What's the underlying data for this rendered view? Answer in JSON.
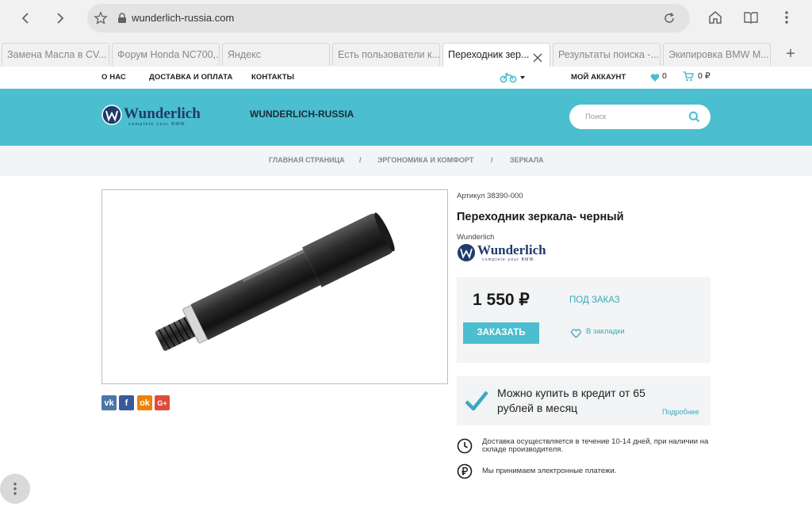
{
  "browser": {
    "url": "wunderlich-russia.com",
    "tabs": [
      {
        "title": "Замена Масла в CV..."
      },
      {
        "title": "Форум Honda NC700,..."
      },
      {
        "title": "Яндекс"
      },
      {
        "title": "Есть пользователи к..."
      },
      {
        "title": "Переходник зер..."
      },
      {
        "title": "Результаты поиска -..."
      },
      {
        "title": "Экипировка BMW M..."
      }
    ],
    "new_tab": "+"
  },
  "topbar": {
    "about": "О НАС",
    "delivery": "ДОСТАВКА И ОПЛАТА",
    "contacts": "КОНТАКТЫ",
    "account": "МОЙ АККАУНТ",
    "wishlist_count": "0",
    "cart_total": "0 ₽"
  },
  "header": {
    "logo_text": "Wunderlich",
    "logo_tagline": "complete your BMW.",
    "site_name": "WUNDERLICH-RUSSIA",
    "search_placeholder": "Поиск"
  },
  "breadcrumb": {
    "items": [
      "ГЛАВНАЯ СТРАНИЦА",
      "ЭРГОНОМИКА И КОМФОРТ",
      "ЗЕРКАЛА"
    ],
    "separator": "/"
  },
  "product": {
    "sku": "Артикул 38390-000",
    "title": "Переходник зеркала- черный",
    "brand": "Wunderlich",
    "price": "1 550 ₽",
    "availability": "ПОД ЗАКАЗ",
    "order_button": "ЗАКАЗАТЬ",
    "bookmark": "В закладки",
    "share": [
      {
        "icon": "vk-icon",
        "label": "vk",
        "color": "#4a76a8"
      },
      {
        "icon": "facebook-icon",
        "label": "f",
        "color": "#3b5998"
      },
      {
        "icon": "odnoklassniki-icon",
        "label": "ok",
        "color": "#ee8208"
      },
      {
        "icon": "google-plus-icon",
        "label": "G+",
        "color": "#dd4b39"
      }
    ]
  },
  "credit": {
    "text": "Можно купить в кредит от 65 рублей в месяц",
    "more": "Подробнее"
  },
  "info": {
    "delivery": "Доставка осуществляется в течение 10-14 дней, при наличии на складе производителя.",
    "payment": "Мы принимаем электронные платежи."
  },
  "colors": {
    "accent": "#4bbecf",
    "accent_text": "#3aa9bd",
    "panel": "#f2f4f5",
    "logo_navy": "#1f3a6b"
  }
}
